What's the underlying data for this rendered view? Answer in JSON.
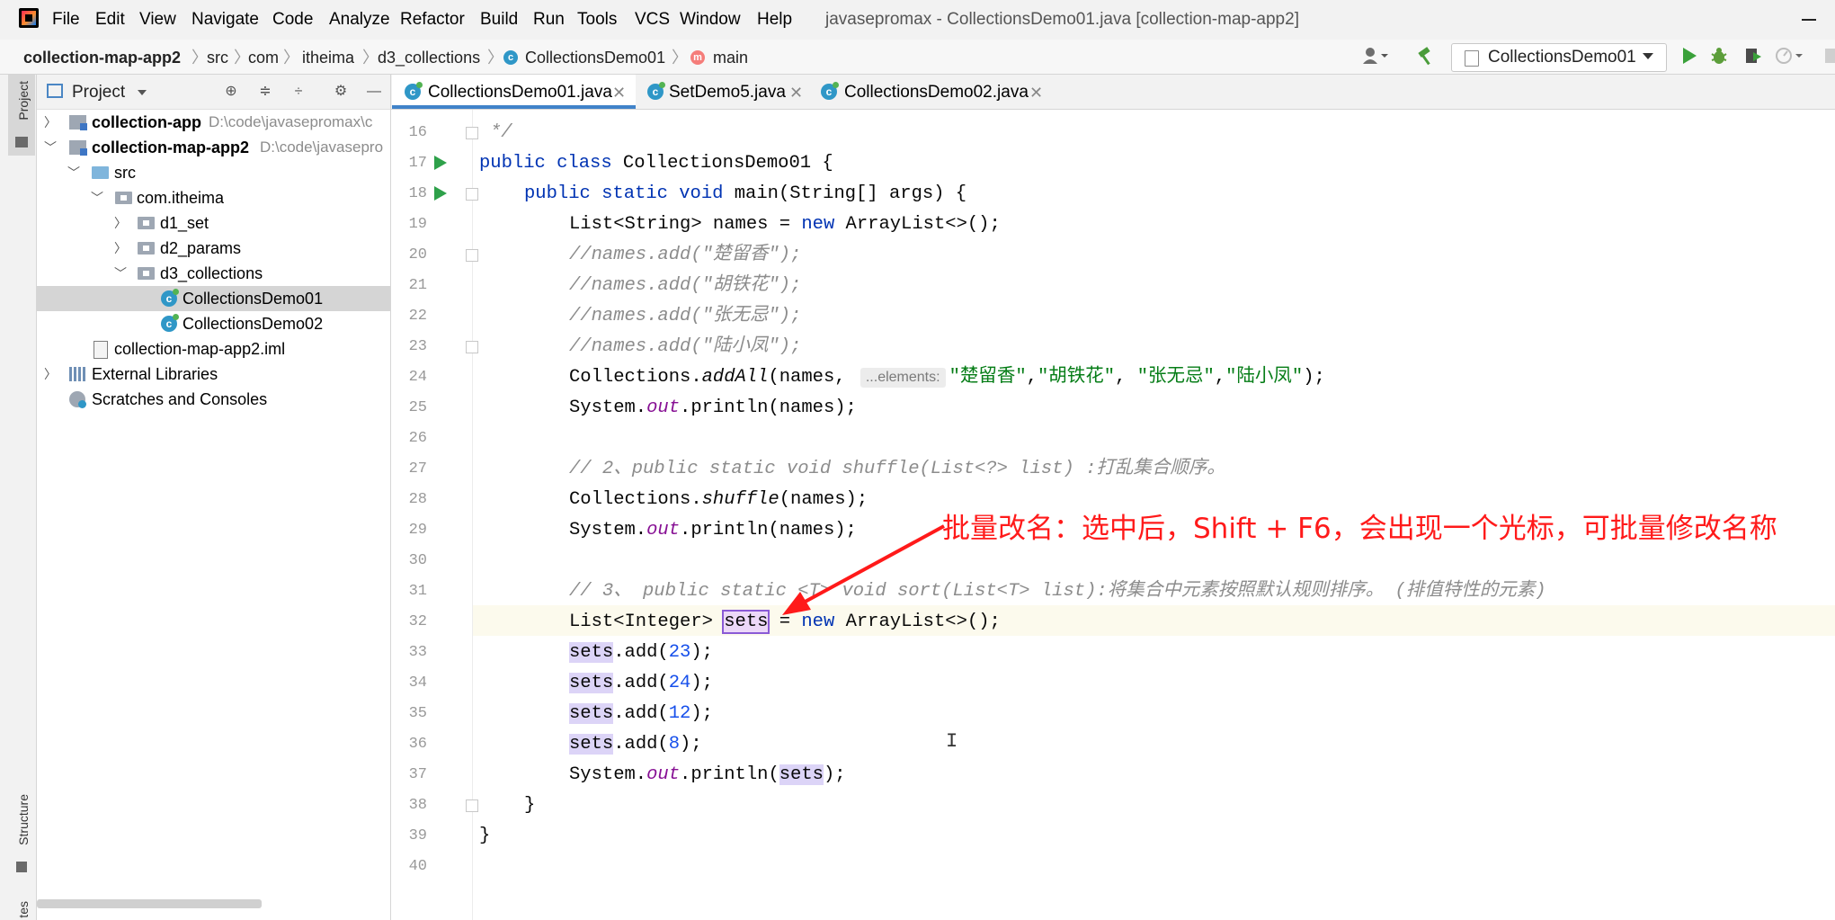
{
  "menu": {
    "items": [
      "File",
      "Edit",
      "View",
      "Navigate",
      "Code",
      "Analyze",
      "Refactor",
      "Build",
      "Run",
      "Tools",
      "VCS",
      "Window",
      "Help"
    ],
    "window_title": "javasepromax - CollectionsDemo01.java [collection-map-app2]"
  },
  "breadcrumb": {
    "project": "collection-map-app2",
    "items": [
      "src",
      "com",
      "itheima",
      "d3_collections",
      "CollectionsDemo01",
      "main"
    ]
  },
  "toolbar": {
    "run_config": "CollectionsDemo01"
  },
  "project_panel": {
    "title": "Project",
    "tree": [
      {
        "label": "collection-app",
        "path": "D:\\code\\javasepromax\\c"
      },
      {
        "label": "collection-map-app2",
        "path": "D:\\code\\javasepro"
      },
      {
        "label": "src"
      },
      {
        "label": "com.itheima"
      },
      {
        "label": "d1_set"
      },
      {
        "label": "d2_params"
      },
      {
        "label": "d3_collections"
      },
      {
        "label": "CollectionsDemo01"
      },
      {
        "label": "CollectionsDemo02"
      },
      {
        "label": "collection-map-app2.iml"
      },
      {
        "label": "External Libraries"
      },
      {
        "label": "Scratches and Consoles"
      }
    ]
  },
  "tool_strip": {
    "project": "Project",
    "structure": "Structure",
    "bottom": "tes"
  },
  "editor": {
    "tabs": [
      "CollectionsDemo01.java",
      "SetDemo5.java",
      "CollectionsDemo02.java"
    ],
    "line_numbers": [
      "16",
      "17",
      "18",
      "19",
      "20",
      "21",
      "22",
      "23",
      "24",
      "25",
      "26",
      "27",
      "28",
      "29",
      "30",
      "31",
      "32",
      "33",
      "34",
      "35",
      "36",
      "37",
      "38",
      "39",
      "40"
    ],
    "code": {
      "l16": "*/",
      "l17_kw": "public class",
      "l17_rest": " CollectionsDemo01 {",
      "l18_kw": "public static void",
      "l18_rest": " main(String[] args) {",
      "l19_a": "List<String> names = ",
      "l19_kw": "new",
      "l19_b": " ArrayList<>();",
      "l20": "//names.add(\"楚留香\");",
      "l21": "//names.add(\"胡铁花\");",
      "l22": "//names.add(\"张无忌\");",
      "l23": "//names.add(\"陆小凤\");",
      "l24_a": "Collections.",
      "l24_fn": "addAll",
      "l24_b": "(names, ",
      "l24_hint": "...elements:",
      "l24_s1": "\"楚留香\"",
      "l24_s2": "\"胡铁花\"",
      "l24_s3": "\"张无忌\"",
      "l24_s4": "\"陆小凤\"",
      "l24_end": ");",
      "sys": "System.",
      "out": "out",
      "println_names": ".println(names);",
      "l27": "// 2、public static void shuffle(List<?> list) :打乱集合顺序。",
      "l28_a": "Collections.",
      "l28_fn": "shuffle",
      "l28_b": "(names);",
      "l31": "// 3、 public static <T> void sort(List<T> list):将集合中元素按照默认规则排序。 (排值特性的元素)",
      "l32_a": "List<Integer> ",
      "sets": "sets",
      "l32_eq": " = ",
      "l32_kw": "new",
      "l32_b": " ArrayList<>();",
      "add_open": ".add(",
      "n23": "23",
      "n24": "24",
      "n12": "12",
      "n8": "8",
      "add_close": ");",
      "println_open": ".println(",
      "brace": "}",
      "cursor": "I"
    }
  },
  "annotation": {
    "text": "批量改名：选中后，Shift + F6，会出现一个光标，可批量修改名称",
    "color": "#ff1a1a"
  },
  "colors": {
    "keyword": "#0033b3",
    "comment": "#8c8c8c",
    "string": "#067d17",
    "number": "#1750eb",
    "static_field": "#871094",
    "rename_highlight": "#dcd4f7",
    "active_tab_underline": "#4083c9"
  },
  "icons": [
    "app-logo-icon",
    "class-icon",
    "method-icon",
    "user-icon",
    "hammer-icon",
    "run-icon",
    "debug-icon",
    "coverage-icon",
    "profile-icon",
    "stop-icon",
    "locate-icon",
    "expand-all-icon",
    "collapse-all-icon",
    "gear-icon",
    "minimize-icon"
  ]
}
